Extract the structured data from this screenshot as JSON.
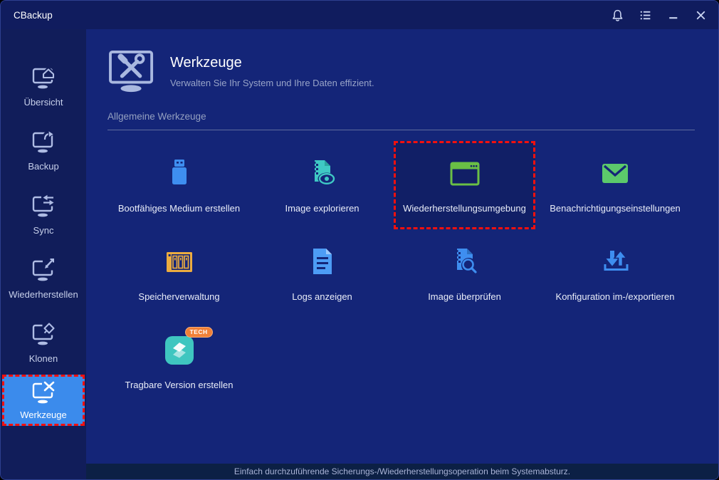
{
  "window": {
    "title": "CBackup"
  },
  "titlebar": {
    "icons": [
      "bell-icon",
      "menu-list-icon",
      "minimize-icon",
      "close-icon"
    ]
  },
  "sidebar": {
    "items": [
      {
        "label": "Übersicht",
        "icon": "monitor-home-icon",
        "selected": false
      },
      {
        "label": "Backup",
        "icon": "monitor-backup-icon",
        "selected": false
      },
      {
        "label": "Sync",
        "icon": "monitor-sync-icon",
        "selected": false
      },
      {
        "label": "Wiederherstellen",
        "icon": "monitor-restore-icon",
        "selected": false
      },
      {
        "label": "Klonen",
        "icon": "monitor-clone-icon",
        "selected": false
      },
      {
        "label": "Werkzeuge",
        "icon": "monitor-tools-icon",
        "selected": true,
        "highlight_border": "red-dashed"
      }
    ]
  },
  "header": {
    "title": "Werkzeuge",
    "subtitle": "Verwalten Sie Ihr System und Ihre Daten effizient.",
    "icon": "monitor-tools-large-icon"
  },
  "section": {
    "title": "Allgemeine Werkzeuge"
  },
  "tools": [
    {
      "label": "Bootfähiges Medium erstellen",
      "icon": "usb-drive-icon",
      "color": "#3E8EF0"
    },
    {
      "label": "Image explorieren",
      "icon": "image-explore-icon",
      "color": "#3FC9C4"
    },
    {
      "label": "Wiederherstellungsumgebung",
      "icon": "recovery-window-icon",
      "color": "#6ABF45",
      "highlighted": true,
      "highlight_border": "red-dashed"
    },
    {
      "label": "Benachrichtigungseinstellungen",
      "icon": "mail-icon",
      "color": "#5CC96B"
    },
    {
      "label": "Speicherverwaltung",
      "icon": "storage-icon",
      "color": "#ECAC3F"
    },
    {
      "label": "Logs anzeigen",
      "icon": "log-document-icon",
      "color": "#4D9CF5"
    },
    {
      "label": "Image überprüfen",
      "icon": "image-check-icon",
      "color": "#3E8EF0"
    },
    {
      "label": "Konfiguration im-/exportieren",
      "icon": "import-export-icon",
      "color": "#3E8EF0"
    },
    {
      "label": "Tragbare Version erstellen",
      "icon": "portable-app-icon",
      "color": "#3FC6C0",
      "badge": "TECH"
    }
  ],
  "statusbar": {
    "text": "Einfach durchzuführende Sicherungs-/Wiederherstellungsoperation beim Systemabsturz."
  },
  "colors": {
    "titlebar_bg": "#101C5E",
    "sidebar_bg": "#111D5A",
    "main_bg": "#142578",
    "selected_nav_bg": "#3B8BEC",
    "highlight_tile_bg": "#111F66",
    "statusbar_bg": "#0C2045",
    "red_dashed_border": "#F3100E",
    "accent_blue": "#3E8EF0",
    "accent_teal": "#3FC9C4",
    "accent_green": "#6ABF45",
    "accent_orange": "#ECAC3F",
    "badge_orange": "#F08037"
  }
}
